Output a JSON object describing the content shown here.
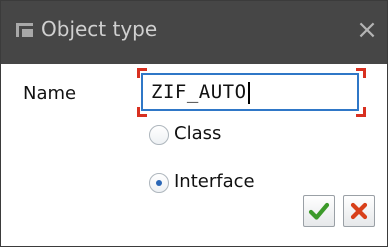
{
  "dialog": {
    "title": "Object type",
    "title_icon": "dialog-icon",
    "close_label": "×"
  },
  "form": {
    "name_label": "Name",
    "name_value": "ZIF_AUTO",
    "radios": [
      {
        "label": "Class",
        "selected": false
      },
      {
        "label": "Interface",
        "selected": true
      }
    ]
  },
  "buttons": {
    "ok_icon": "checkmark-icon",
    "cancel_icon": "cross-icon"
  },
  "colors": {
    "titlebar": "#464646",
    "focus_border": "#2f77c7",
    "focus_corners": "#d83020",
    "ok_green": "#3c9a2a",
    "cancel_red": "#d8401a"
  }
}
